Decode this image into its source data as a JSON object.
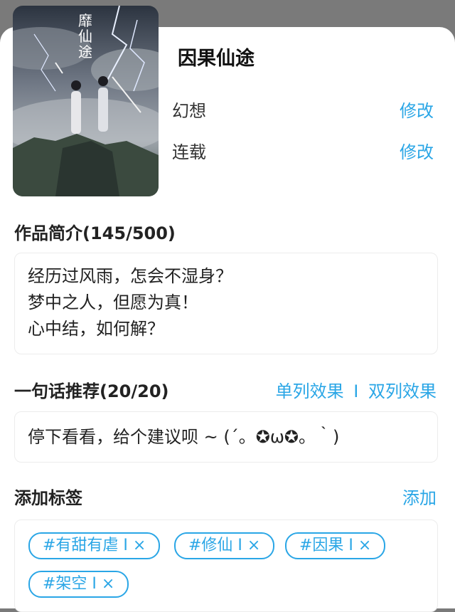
{
  "book": {
    "title": "因果仙途",
    "cover_text": "靡仙途",
    "genre": "幻想",
    "status": "连载",
    "edit_label": "修改"
  },
  "intro": {
    "heading": "作品简介(145/500)",
    "text": "经历过风雨，怎会不湿身？\n梦中之人，但愿为真！\n心中结，如何解？"
  },
  "recommend": {
    "heading": "一句话推荐(20/20)",
    "single_label": "单列效果",
    "separator": "I",
    "double_label": "双列效果",
    "text": "停下看看，给个建议呗 ~ (´。✪ω✪。｀)"
  },
  "tags": {
    "heading": "添加标签",
    "add_label": "添加",
    "items": [
      "#有甜有虐 I ×",
      "#修仙 I ×",
      "#因果 I ×",
      "#架空 I ×"
    ]
  }
}
